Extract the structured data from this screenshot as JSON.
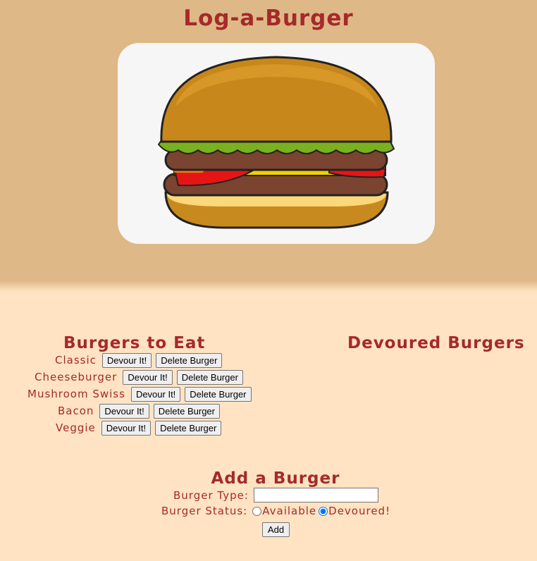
{
  "app": {
    "title": "Log-a-Burger"
  },
  "hero": {
    "image_icon": "hamburger-illustration"
  },
  "columns": {
    "to_eat_title": "Burgers to Eat",
    "devoured_title": "Devoured Burgers"
  },
  "burgers_to_eat": [
    {
      "name": "Classic",
      "devour_label": "Devour It!",
      "delete_label": "Delete Burger"
    },
    {
      "name": "Cheeseburger",
      "devour_label": "Devour It!",
      "delete_label": "Delete Burger"
    },
    {
      "name": "Mushroom Swiss",
      "devour_label": "Devour It!",
      "delete_label": "Delete Burger"
    },
    {
      "name": "Bacon",
      "devour_label": "Devour It!",
      "delete_label": "Delete Burger"
    },
    {
      "name": "Veggie",
      "devour_label": "Devour It!",
      "delete_label": "Delete Burger"
    }
  ],
  "devoured_burgers": [],
  "add_form": {
    "title": "Add a Burger",
    "type_label": "Burger Type:",
    "type_value": "",
    "status_label": "Burger Status:",
    "status_options": [
      "Available",
      "Devoured!"
    ],
    "status_selected": "Devoured!",
    "submit_label": "Add"
  },
  "colors": {
    "header_bg": "#deb887",
    "page_bg": "#ffe3c3",
    "text": "#a52a2a"
  }
}
